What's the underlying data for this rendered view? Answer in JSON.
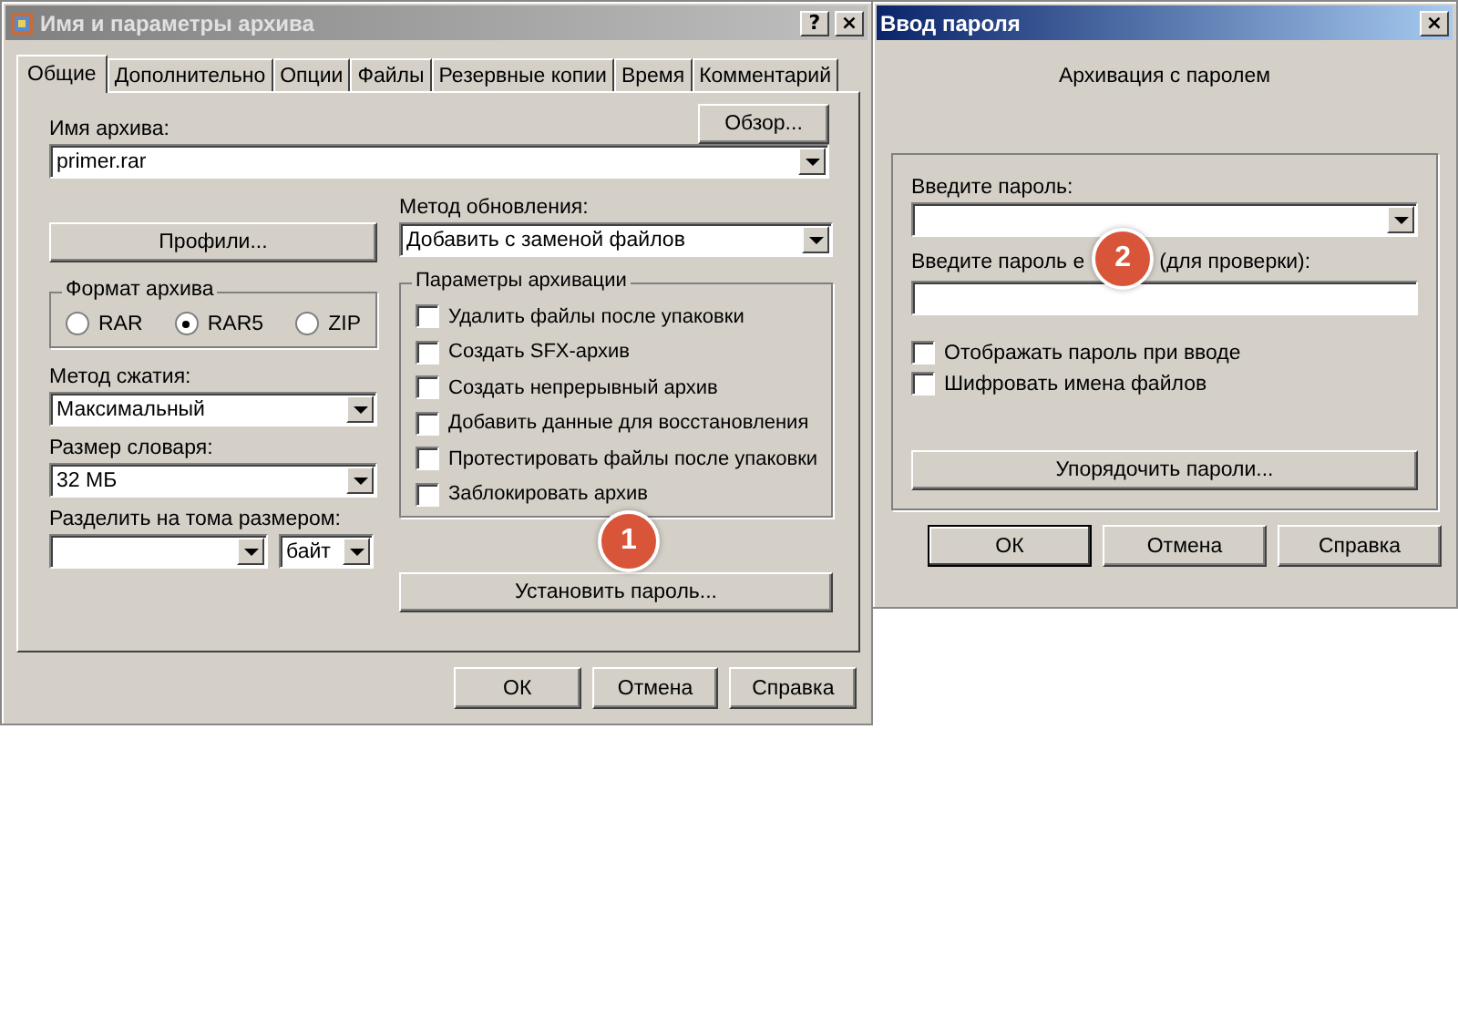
{
  "archive_dialog": {
    "title": "Имя и параметры архива",
    "help_button": "?",
    "close_button": "×",
    "tabs": [
      {
        "label": "Общие",
        "selected": true
      },
      {
        "label": "Дополнительно",
        "selected": false
      },
      {
        "label": "Опции",
        "selected": false
      },
      {
        "label": "Файлы",
        "selected": false
      },
      {
        "label": "Резервные копии",
        "selected": false
      },
      {
        "label": "Время",
        "selected": false
      },
      {
        "label": "Комментарий",
        "selected": false
      }
    ],
    "archive_name_label": "Имя архива:",
    "browse_button": "Обзор...",
    "archive_name": "primer.rar",
    "profiles_button": "Профили...",
    "update_method_label": "Метод обновления:",
    "update_method": "Добавить с заменой файлов",
    "format_group": {
      "title": "Формат архива",
      "options": [
        {
          "label": "RAR",
          "selected": false
        },
        {
          "label": "RAR5",
          "selected": true
        },
        {
          "label": "ZIP",
          "selected": false
        }
      ]
    },
    "compression_label": "Метод сжатия:",
    "compression": "Максимальный",
    "dictionary_label": "Размер словаря:",
    "dictionary": "32 МБ",
    "split_label": "Разделить на тома размером:",
    "split_unit": "байт",
    "options_group": {
      "title": "Параметры архивации",
      "options": [
        {
          "label": "Удалить файлы после упаковки",
          "checked": false
        },
        {
          "label": "Создать SFX-архив",
          "checked": false
        },
        {
          "label": "Создать непрерывный архив",
          "checked": false
        },
        {
          "label": "Добавить данные для восстановления",
          "checked": false
        },
        {
          "label": "Протестировать файлы после упаковки",
          "checked": false
        },
        {
          "label": "Заблокировать архив",
          "checked": false
        }
      ]
    },
    "password_button": "Установить пароль...",
    "step_badge": "1",
    "buttons": [
      {
        "label": "ОК",
        "default": false
      },
      {
        "label": "Отмена",
        "default": false
      },
      {
        "label": "Справка",
        "default": false
      }
    ]
  },
  "password_dialog": {
    "title": "Ввод пароля",
    "close_button": "×",
    "heading": "Архивация с паролем",
    "password_label": "Введите пароль:",
    "confirm_label_start": "Введите пароль е",
    "confirm_label_end": "(для проверки):",
    "step_badge": "2",
    "options": [
      {
        "label": "Отображать пароль при вводе",
        "checked": false
      },
      {
        "label": "Шифровать имена файлов",
        "checked": false
      }
    ],
    "organize_button": "Упорядочить пароли...",
    "buttons": [
      {
        "label": "ОК",
        "default": true
      },
      {
        "label": "Отмена",
        "default": false
      },
      {
        "label": "Справка",
        "default": false
      }
    ]
  }
}
